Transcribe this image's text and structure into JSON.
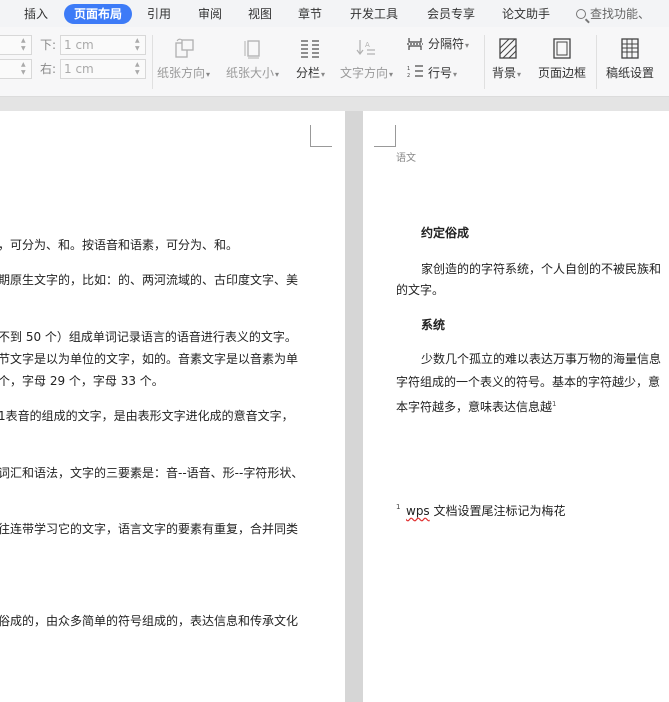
{
  "menu": {
    "items": [
      "插入",
      "页面布局",
      "引用",
      "审阅",
      "视图",
      "章节",
      "开发工具",
      "会员专享",
      "论文助手"
    ],
    "active": "页面布局",
    "search_placeholder": "查找功能、"
  },
  "ribbon": {
    "margin_bottom_label": "下:",
    "margin_bottom_value": "1 cm",
    "margin_right_label": "右:",
    "margin_right_value": "1 cm",
    "orientation_label": "纸张方向",
    "size_label": "纸张大小",
    "columns_label": "分栏",
    "text_direction_label": "文字方向",
    "separator_label": "分隔符",
    "line_number_label": "行号",
    "background_label": "背景",
    "page_border_label": "页面边框",
    "grid_paper_label": "稿纸设置"
  },
  "left_page": {
    "lines": [
      "，可分为、和。按语音和语素，可分为、和。",
      "期原生文字的，比如：的、两河流域的、古印度文字、美",
      "不到 50 个）组成单词记录语言的语音进行表义的文字。",
      "节文字是以为单位的文字，如的。音素文字是以音素为单",
      "个，字母 29 个，字母 33 个。",
      "1表音的组成的文字，是由表形文字进化成的意音文字，",
      "词汇和语法，文字的三要素是：音--语音、形--字符形状、",
      "往连带学习它的文字，语言文字的要素有重复，合并同类",
      "俗成的，由众多简单的符号组成的，表达信息和传承文化"
    ]
  },
  "right_page": {
    "header": "语文",
    "heading1": "约定俗成",
    "para1_line1": "家创造的的字符系统，个人自创的不被民族和",
    "para1_line2": "的文字。",
    "heading2": "系统",
    "para2_line1": "少数几个孤立的难以表达万事万物的海量信息",
    "para2_line2": "字符组成的一个表义的符号。基本的字符越少，意",
    "para2_line3": "本字符越多，意味表达信息越",
    "endnote_ref": "1",
    "footnote_number": "1",
    "footnote_wps": "wps",
    "footnote_text": " 文档设置尾注标记为梅花"
  }
}
